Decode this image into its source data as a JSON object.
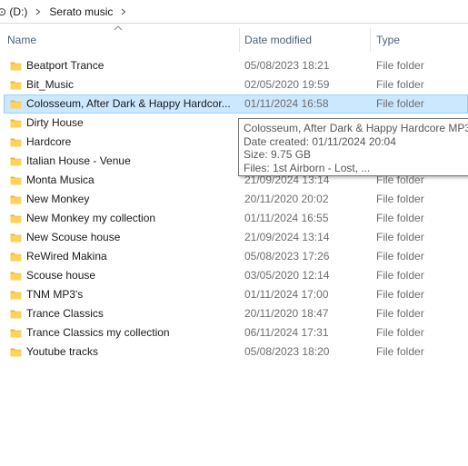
{
  "breadcrumb": {
    "drive": "⊙ (D:)",
    "folder": "Serato music"
  },
  "columns": {
    "name": "Name",
    "date_modified": "Date modified",
    "type": "Type"
  },
  "files": [
    {
      "name": "Beatport Trance",
      "date": "05/08/2023 18:21",
      "type": "File folder"
    },
    {
      "name": "Bit_Music",
      "date": "02/05/2020 19:59",
      "type": "File folder"
    },
    {
      "name": "Colosseum, After Dark & Happy Hardcor...",
      "date": "01/11/2024 16:58",
      "type": "File folder"
    },
    {
      "name": "Dirty House",
      "date": "",
      "type": ""
    },
    {
      "name": "Hardcore",
      "date": "",
      "type": ""
    },
    {
      "name": "Italian House - Venue",
      "date": "",
      "type": ""
    },
    {
      "name": "Monta Musica",
      "date": "21/09/2024 13:14",
      "type": "File folder"
    },
    {
      "name": "New Monkey",
      "date": "20/11/2020 20:02",
      "type": "File folder"
    },
    {
      "name": "New Monkey my collection",
      "date": "01/11/2024 16:55",
      "type": "File folder"
    },
    {
      "name": "New Scouse house",
      "date": "21/09/2024 13:14",
      "type": "File folder"
    },
    {
      "name": "ReWired Makina",
      "date": "05/08/2023 17:26",
      "type": "File folder"
    },
    {
      "name": "Scouse house",
      "date": "03/05/2020 12:14",
      "type": "File folder"
    },
    {
      "name": "TNM MP3's",
      "date": "01/11/2024 17:00",
      "type": "File folder"
    },
    {
      "name": "Trance Classics",
      "date": "20/11/2020 18:47",
      "type": "File folder"
    },
    {
      "name": "Trance Classics my collection",
      "date": "06/11/2024 17:31",
      "type": "File folder"
    },
    {
      "name": "Youtube tracks",
      "date": "05/08/2023 18:20",
      "type": "File folder"
    }
  ],
  "tooltip": {
    "title": "Colosseum, After Dark & Happy Hardcore MP3",
    "date_created": "Date created: 01/11/2024 20:04",
    "size": "Size: 9.75 GB",
    "files": "Files: 1st Airborn - Lost, ..."
  },
  "colors": {
    "selection_bg": "#cce8ff",
    "selection_border": "#99d1ff",
    "folder_yellow": "#ffd25a",
    "header_text": "#4c607a"
  },
  "icons": {
    "folder": "folder-icon",
    "chevron": "chevron-right-icon",
    "sort": "sort-up-icon"
  }
}
